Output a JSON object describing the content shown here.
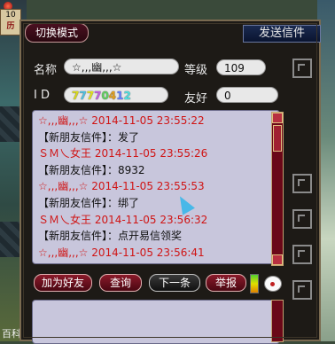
{
  "corner": {
    "top": "10",
    "bottom": "历"
  },
  "bottom_text": "百科",
  "window": {
    "switch_mode_label": "切换模式",
    "title": "发送信件"
  },
  "profile": {
    "name_label": "名称",
    "name_value": "☆,,,幽,,,☆",
    "level_label": "等级",
    "level_value": "109",
    "id_label": "I  D",
    "id_digits": [
      {
        "ch": "7",
        "color": "#d8d820"
      },
      {
        "ch": "7",
        "color": "#50c0e0"
      },
      {
        "ch": "7",
        "color": "#e0e020"
      },
      {
        "ch": "7",
        "color": "#c060e0"
      },
      {
        "ch": "0",
        "color": "#60d060"
      },
      {
        "ch": "4",
        "color": "#e0a020"
      },
      {
        "ch": "1",
        "color": "#6080ff"
      },
      {
        "ch": "2",
        "color": "#50e0e0"
      }
    ],
    "friend_label": "友好",
    "friend_value": "0"
  },
  "messages": [
    {
      "text": "☆,,,幽,,,☆  2014-11-05 23:55:22",
      "color": "red"
    },
    {
      "text": "【新朋友信件】：发了",
      "color": "black"
    },
    {
      "text": "ＳＭ乀女王  2014-11-05 23:55:26",
      "color": "red"
    },
    {
      "text": "【新朋友信件】：8932",
      "color": "black"
    },
    {
      "text": "☆,,,幽,,,☆  2014-11-05 23:55:53",
      "color": "red"
    },
    {
      "text": "【新朋友信件】：绑了",
      "color": "black"
    },
    {
      "text": "ＳＭ乀女王  2014-11-05 23:56:32",
      "color": "red"
    },
    {
      "text": "【新朋友信件】：点开易信领奖",
      "color": "black"
    },
    {
      "text": "☆,,,幽,,,☆  2014-11-05 23:56:41",
      "color": "red"
    }
  ],
  "buttons": {
    "add_friend": "加为好友",
    "query": "查询",
    "next": "下一条",
    "report": "举报"
  },
  "colors": {
    "accent_red": "#d01414",
    "panel_bg": "#c8c6dc",
    "window_bg": "#1d1a16"
  }
}
